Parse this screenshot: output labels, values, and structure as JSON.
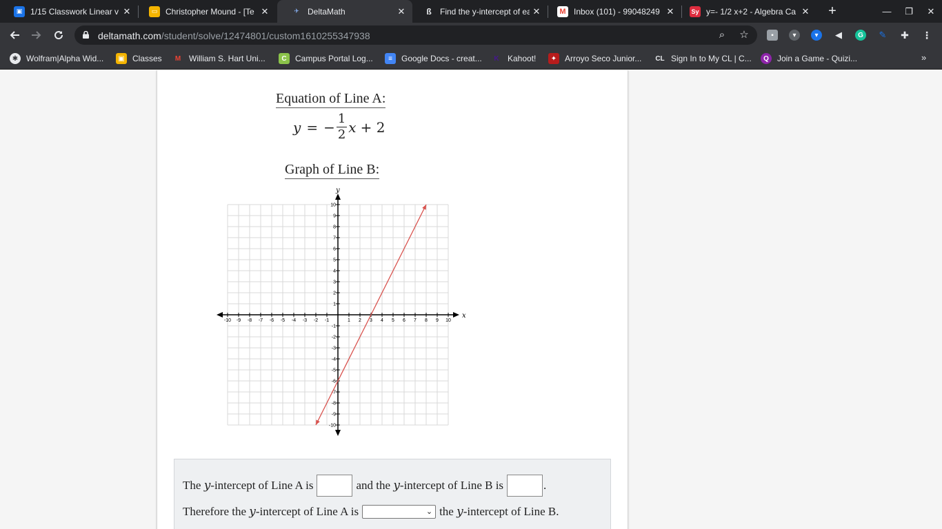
{
  "browser": {
    "tabs": [
      {
        "title": "1/15 Classwork Linear v",
        "icon_color": "#1a73e8",
        "icon": "classroom-icon",
        "active": false
      },
      {
        "title": "Christopher Mound - [Te",
        "icon_color": "#f4b400",
        "icon": "slides-icon",
        "active": false
      },
      {
        "title": "DeltaMath",
        "icon_color": "#35363a",
        "icon": "deltamath-icon",
        "active": true
      },
      {
        "title": "Find the y-intercept of ea",
        "icon_color": "#202124",
        "icon": "brainly-icon",
        "active": false
      },
      {
        "title": "Inbox (101) - 99048249",
        "icon_color": "#ffffff",
        "icon": "gmail-icon",
        "active": false
      },
      {
        "title": "y=- 1/2 x+2 - Algebra Ca",
        "icon_color": "#dd2c3e",
        "icon": "symbolab-icon",
        "active": false
      }
    ],
    "symbolab_favicon_text": "Sy",
    "close_glyph": "✕",
    "new_tab_glyph": "+",
    "url_domain": "deltamath.com",
    "url_path": "/student/solve/12474801/custom1610255347938",
    "bookmarks": [
      {
        "label": "Wolfram|Alpha Wid...",
        "icon_color": "#e8eaed"
      },
      {
        "label": "Classes",
        "icon_color": "#f4b400"
      },
      {
        "label": "William S. Hart Uni...",
        "icon_color": "#ea4335"
      },
      {
        "label": "Campus Portal Log...",
        "icon_color": "#8bc34a"
      },
      {
        "label": "Google Docs - creat...",
        "icon_color": "#4285f4"
      },
      {
        "label": "Kahoot!",
        "icon_color": "#46178f"
      },
      {
        "label": "Arroyo Seco Junior...",
        "icon_color": "#b71c1c"
      },
      {
        "label": "Sign In to My CL | C...",
        "icon_color": "#202124"
      },
      {
        "label": "Join a Game - Quizi...",
        "icon_color": "#8e24aa"
      }
    ],
    "bookmark_glyphs": {
      "campus": "C",
      "cl": "CL",
      "quizizz": "Q"
    }
  },
  "problem": {
    "line_a_heading": "Equation of Line A:",
    "eq": {
      "y": "y",
      "equals": "=",
      "minus": "−",
      "num": "1",
      "den": "2",
      "x": "x",
      "plus_const": "+ 2"
    },
    "line_b_heading": "Graph of Line B:"
  },
  "chart_data": {
    "type": "line",
    "xlabel": "x",
    "ylabel": "y",
    "xlim": [
      -10,
      10
    ],
    "ylim": [
      -10,
      10
    ],
    "grid": true,
    "ticks": [
      -10,
      -9,
      -8,
      -7,
      -6,
      -5,
      -4,
      -3,
      -2,
      -1,
      1,
      2,
      3,
      4,
      5,
      6,
      7,
      8,
      9,
      10
    ],
    "series": [
      {
        "points": [
          [
            -2,
            -10
          ],
          [
            8,
            10
          ]
        ],
        "color": "#d9534f"
      }
    ]
  },
  "answer": {
    "part1_a": "The ",
    "part1_var": "y",
    "part1_b": "-intercept of Line A is",
    "part1_c": "and the ",
    "part1_d": "-intercept of Line B is",
    "part1_end": ".",
    "part2_a": "Therefore the ",
    "part2_b": "-intercept of Line A is",
    "part2_c": "the ",
    "part2_d": "-intercept of Line B."
  }
}
